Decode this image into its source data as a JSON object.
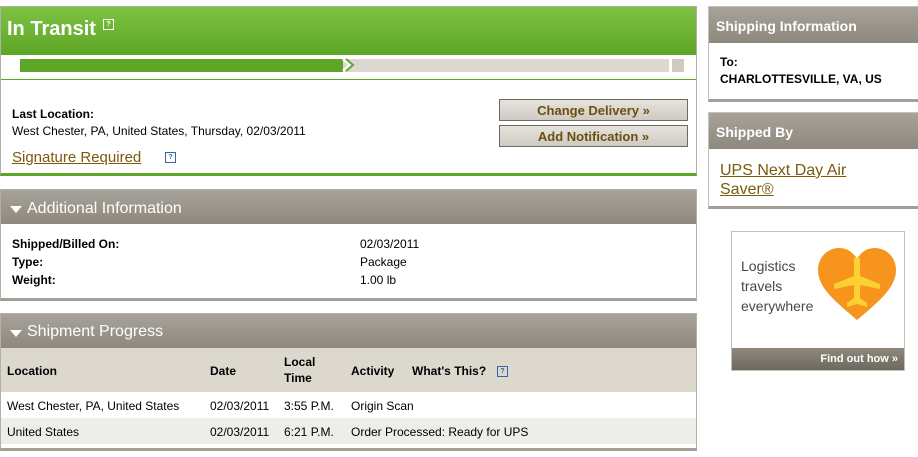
{
  "status": {
    "title": "In Transit",
    "help_label": "?",
    "progress_fraction": 0.5,
    "last_location_label": "Last Location:",
    "last_location_value": "West Chester, PA, United States, Thursday, 02/03/2011",
    "signature_link": "Signature Required",
    "buttons": {
      "change_delivery": "Change Delivery »",
      "add_notification": "Add Notification »"
    }
  },
  "additional_info": {
    "title": "Additional Information",
    "rows": [
      {
        "label": "Shipped/Billed On:",
        "value": "02/03/2011"
      },
      {
        "label": "Type:",
        "value": "Package"
      },
      {
        "label": "Weight:",
        "value": "1.00 lb"
      }
    ]
  },
  "shipment_progress": {
    "title": "Shipment Progress",
    "columns": {
      "location": "Location",
      "date": "Date",
      "local_time_1": "Local",
      "local_time_2": "Time",
      "activity": "Activity",
      "whats_this": "What's This?"
    },
    "rows": [
      {
        "location": "West Chester, PA, United States",
        "date": "02/03/2011",
        "time": "3:55 P.M.",
        "activity": "Origin Scan"
      },
      {
        "location": "United States",
        "date": "02/03/2011",
        "time": "6:21 P.M.",
        "activity": "Order Processed: Ready for UPS"
      }
    ]
  },
  "shipping_information": {
    "title": "Shipping Information",
    "to_label": "To:",
    "to_value": "CHARLOTTESVILLE, VA, US"
  },
  "shipped_by": {
    "title": "Shipped By",
    "service": "UPS Next Day Air Saver®"
  },
  "ad": {
    "line1": "Logistics",
    "line2": "travels",
    "line3": "everywhere",
    "cta": "Find out how »"
  },
  "colors": {
    "brand_green": "#5ea626",
    "link_brown": "#7a5a0c",
    "panel_header": "#8e887e",
    "heart_orange": "#f7941d"
  }
}
